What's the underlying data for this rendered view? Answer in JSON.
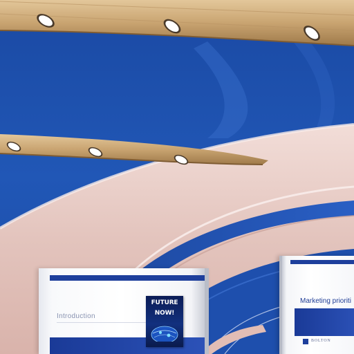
{
  "scene": {
    "background_color": "#1d4faa",
    "ceiling_beams": [
      {
        "material": "light-wood",
        "lights": 3
      },
      {
        "material": "light-wood",
        "lights": 3
      }
    ],
    "curved_wall_color": "#e8c9c2"
  },
  "displays": {
    "left": {
      "label": "Introduction",
      "book": {
        "title_line1": "FUTURE",
        "title_line2": "NOW!"
      }
    },
    "right": {
      "label": "Marketing prioriti",
      "logo_text": "BOLTON"
    }
  }
}
